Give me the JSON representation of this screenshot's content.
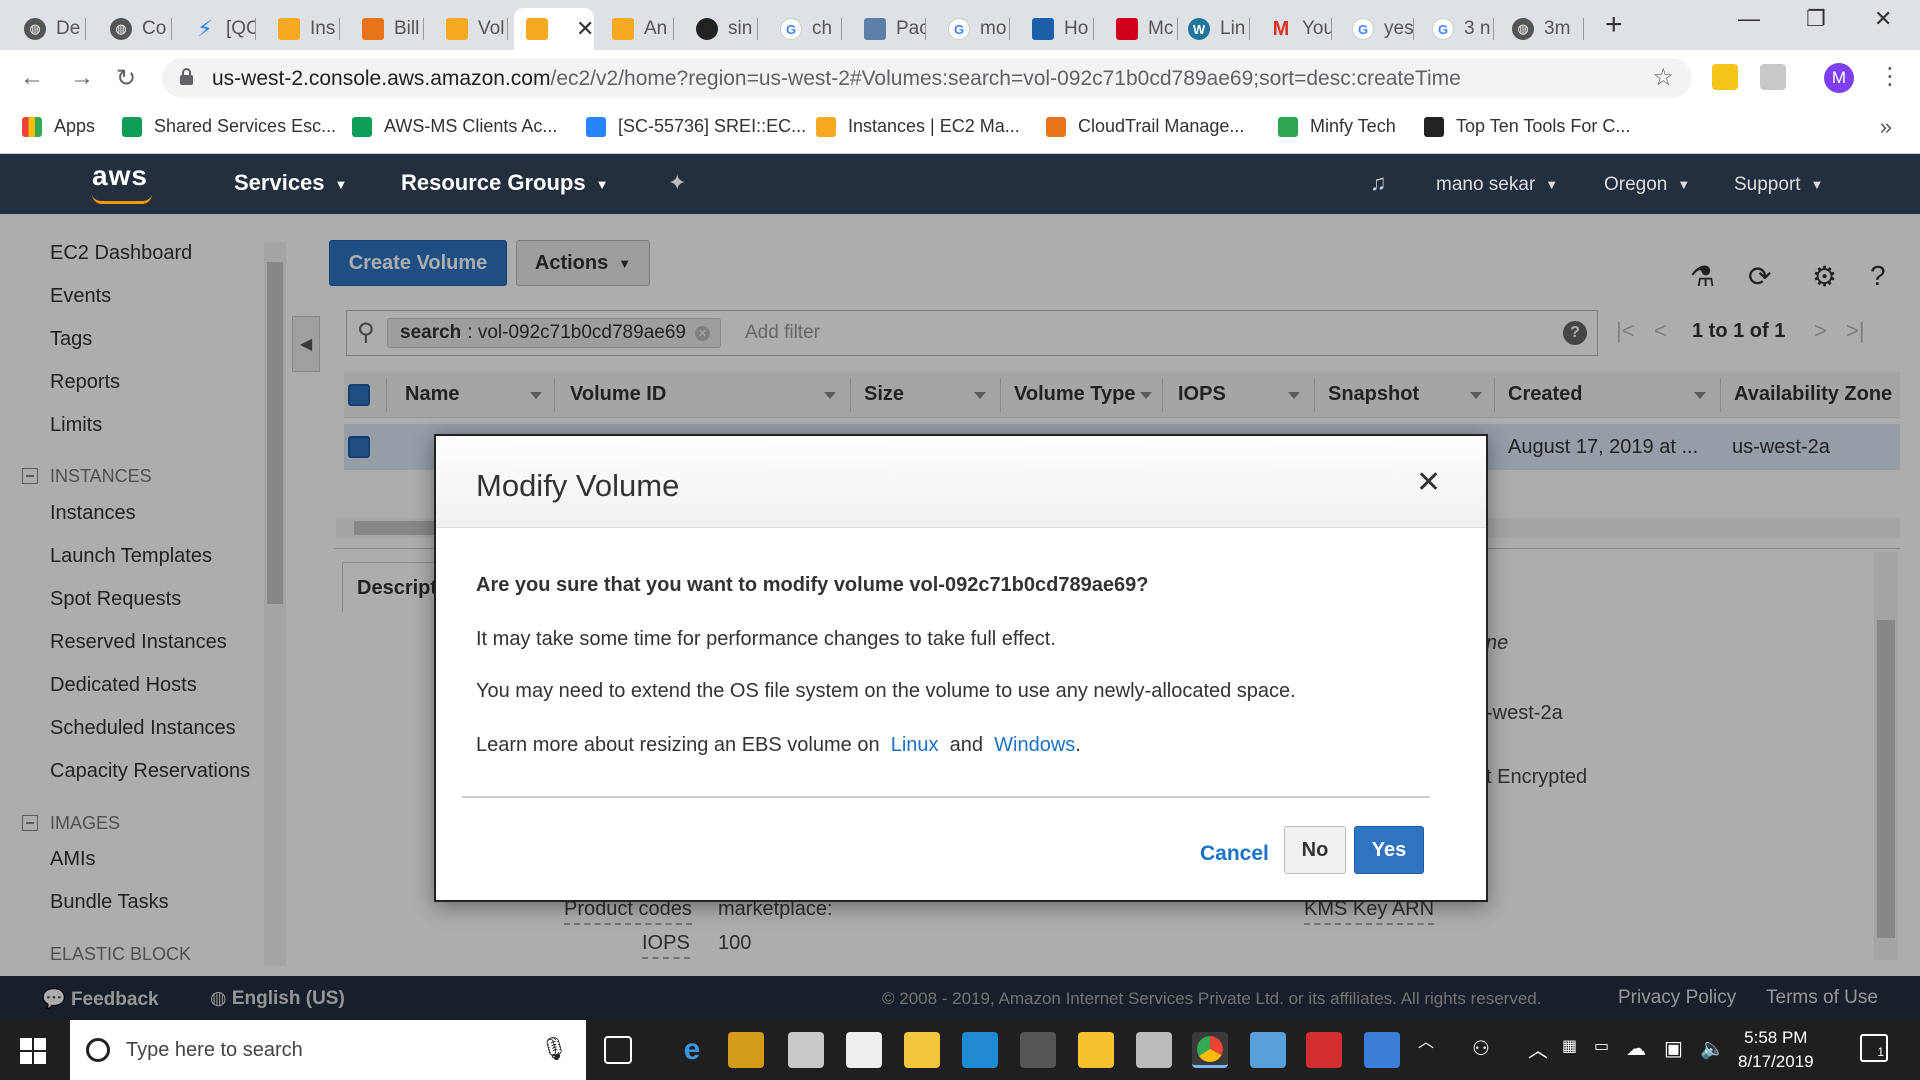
{
  "browser": {
    "tabs": [
      {
        "label": "De",
        "icon": "globe-icon"
      },
      {
        "label": "Co",
        "icon": "globe-icon"
      },
      {
        "label": "[QC",
        "icon": "jira-icon"
      },
      {
        "label": "Ins",
        "icon": "aws-cube-icon"
      },
      {
        "label": "Bill",
        "icon": "aws-billing-icon"
      },
      {
        "label": "Vol",
        "icon": "aws-cube-icon"
      },
      {
        "label": "",
        "icon": "aws-cube-icon",
        "active": true
      },
      {
        "label": "An",
        "icon": "aws-cube-icon"
      },
      {
        "label": "sin",
        "icon": "github-icon"
      },
      {
        "label": "ch",
        "icon": "google-icon"
      },
      {
        "label": "Pac",
        "icon": "app-icon"
      },
      {
        "label": "mo",
        "icon": "google-icon"
      },
      {
        "label": "Ho",
        "icon": "app-icon"
      },
      {
        "label": "Mc",
        "icon": "app-icon"
      },
      {
        "label": "Lin",
        "icon": "wordpress-icon"
      },
      {
        "label": "You",
        "icon": "gmail-icon"
      },
      {
        "label": "yes",
        "icon": "google-icon"
      },
      {
        "label": "3 n",
        "icon": "google-icon"
      },
      {
        "label": "3m",
        "icon": "globe-icon"
      }
    ],
    "url_domain": "us-west-2.console.aws.amazon.com",
    "url_path": "/ec2/v2/home?region=us-west-2#Volumes:search=vol-092c71b0cd789ae69;sort=desc:createTime",
    "avatar_letter": "M",
    "bookmarks": [
      {
        "label": "Apps",
        "color": "#4285f4"
      },
      {
        "label": "Shared Services Esc...",
        "color": "#0f9d58"
      },
      {
        "label": "AWS-MS Clients Ac...",
        "color": "#0f9d58"
      },
      {
        "label": "[SC-55736] SREI::EC...",
        "color": "#2684ff"
      },
      {
        "label": "Instances | EC2 Ma...",
        "color": "#f7a823"
      },
      {
        "label": "CloudTrail Manage...",
        "color": "#e8731b"
      },
      {
        "label": "Minfy Tech",
        "color": "#2ea44f"
      },
      {
        "label": "Top Ten Tools For C...",
        "color": "#222222"
      }
    ]
  },
  "aws": {
    "logo": "aws",
    "nav": {
      "services": "Services",
      "resource_groups": "Resource Groups"
    },
    "user": "mano sekar",
    "region": "Oregon",
    "support": "Support"
  },
  "sidebar": {
    "top_items": [
      "EC2 Dashboard",
      "Events",
      "Tags",
      "Reports",
      "Limits"
    ],
    "instances_header": "INSTANCES",
    "instances_items": [
      "Instances",
      "Launch Templates",
      "Spot Requests",
      "Reserved Instances",
      "Dedicated Hosts",
      "Scheduled Instances",
      "Capacity Reservations"
    ],
    "images_header": "IMAGES",
    "images_items": [
      "AMIs",
      "Bundle Tasks"
    ],
    "ebs_header": "ELASTIC BLOCK"
  },
  "toolbar": {
    "create": "Create Volume",
    "actions": "Actions"
  },
  "filter": {
    "key": "search",
    "value": ": vol-092c71b0cd789ae69",
    "placeholder": "Add filter"
  },
  "pagination": "1 to 1 of 1",
  "table": {
    "columns": [
      "Name",
      "Volume ID",
      "Size",
      "Volume Type",
      "IOPS",
      "Snapshot",
      "Created",
      "Availability Zone"
    ],
    "row": {
      "created": "August 17, 2019 at ...",
      "az": "us-west-2a"
    }
  },
  "details": {
    "tab": "Description",
    "partial_1": "ne",
    "partial_2": "-west-2a",
    "partial_3": "t Encrypted",
    "product_codes_label": "Product codes",
    "product_codes_value": "marketplace:",
    "iops_label": "IOPS",
    "iops_value": "100",
    "kms_label": "KMS Key ARN"
  },
  "footer": {
    "feedback": "Feedback",
    "language": "English (US)",
    "copyright": "© 2008 - 2019, Amazon Internet Services Private Ltd. or its affiliates. All rights reserved.",
    "privacy": "Privacy Policy",
    "terms": "Terms of Use"
  },
  "modal": {
    "title": "Modify Volume",
    "question": "Are you sure that you want to modify volume vol-092c71b0cd789ae69?",
    "line1": "It may take some time for performance changes to take full effect.",
    "line2": "You may need to extend the OS file system on the volume to use any newly-allocated space.",
    "learn_prefix": "Learn more about resizing an EBS volume on",
    "link_linux": "Linux",
    "and": "and",
    "link_windows": "Windows",
    "period": ".",
    "cancel": "Cancel",
    "no": "No",
    "yes": "Yes"
  },
  "taskbar": {
    "search_placeholder": "Type here to search",
    "time": "5:58 PM",
    "date": "8/17/2019",
    "notifications": "1"
  },
  "colors": {
    "aws_dark": "#232f3e",
    "aws_orange": "#ff9900",
    "primary_blue": "#2f74c0",
    "link_blue": "#1a73c8"
  }
}
